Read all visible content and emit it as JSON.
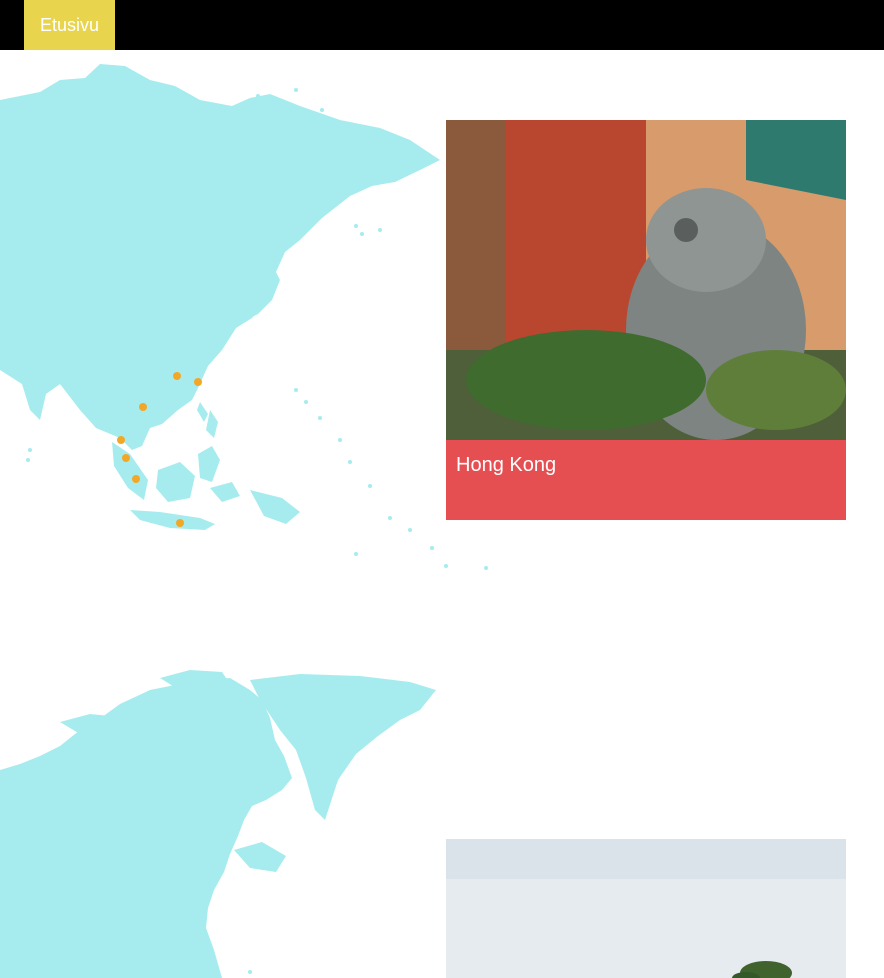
{
  "nav": {
    "home_label": "Etusivu"
  },
  "colors": {
    "nav_background": "#000000",
    "home_button": "#e8d54d",
    "map_fill": "#a6ecef",
    "marker": "#f2a826",
    "card_caption": "#e64f52"
  },
  "sections": [
    {
      "map": {
        "region": "asia",
        "marker_count": 7
      },
      "card": {
        "title": "Hong Kong",
        "image": "temple-stone-lion-photo"
      }
    },
    {
      "map": {
        "region": "north-america"
      },
      "card": {
        "title": "",
        "image": "sky-and-treetop-photo"
      }
    }
  ]
}
